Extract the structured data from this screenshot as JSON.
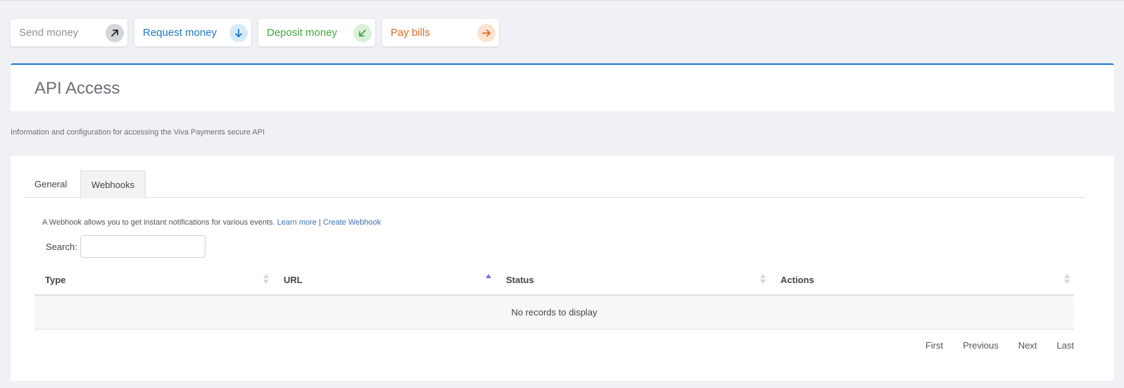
{
  "quick_actions": [
    {
      "label": "Send money",
      "icon": "arrow-up-right-icon",
      "color": "#8c929a"
    },
    {
      "label": "Request money",
      "icon": "arrow-down-icon",
      "color": "#1f78c8"
    },
    {
      "label": "Deposit money",
      "icon": "arrow-down-left-icon",
      "color": "#3daa3e"
    },
    {
      "label": "Pay bills",
      "icon": "arrow-right-icon",
      "color": "#e06a1f"
    }
  ],
  "page": {
    "title": "API Access",
    "subtitle": "Information and configuration for accessing the Viva Payments secure API"
  },
  "tabs": [
    {
      "label": "General",
      "active": false
    },
    {
      "label": "Webhooks",
      "active": true
    }
  ],
  "webhooks": {
    "info_text": "A Webhook allows you to get instant notifications for various events.",
    "learn_more": "Learn more",
    "separator": "|",
    "create_link": "Create Webhook",
    "search_label": "Search:",
    "search_value": ""
  },
  "table": {
    "columns": [
      {
        "label": "Type",
        "sort": "none"
      },
      {
        "label": "URL",
        "sort": "asc"
      },
      {
        "label": "Status",
        "sort": "none"
      },
      {
        "label": "Actions",
        "sort": "none"
      }
    ],
    "empty_message": "No records to display"
  },
  "pagination": {
    "first": "First",
    "previous": "Previous",
    "next": "Next",
    "last": "Last"
  },
  "colors": {
    "accent": "#1976d2",
    "link": "#3d72ad",
    "sort_active": "#6e78d9"
  }
}
